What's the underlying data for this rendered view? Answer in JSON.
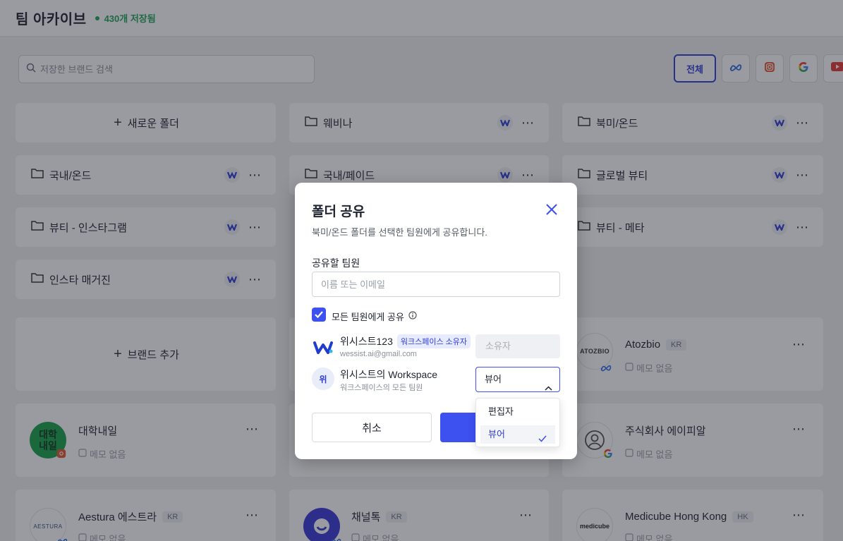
{
  "header": {
    "title": "팀 아카이브",
    "saved_count": "430개 저장됨"
  },
  "search": {
    "placeholder": "저장한 브랜드 검색"
  },
  "filters": {
    "all_label": "전체",
    "icons": [
      "meta-icon",
      "instagram-icon",
      "google-icon",
      "youtube-icon"
    ]
  },
  "folders": {
    "new_folder": "새로운 폴더",
    "items": [
      "웨비나",
      "북미/온드",
      "국내/온드",
      "국내/페이드",
      "글로벌 뷰티",
      "뷰티 - 인스타그램",
      "뷰티 - 메타",
      "인스타 매거진"
    ]
  },
  "brand_add": "브랜드 추가",
  "brands": [
    {
      "name": "Atozbio",
      "region": "KR",
      "memo": "메모 없음",
      "logo_text": "ATOZBIO"
    },
    {
      "name": "대학내일",
      "memo": "메모 없음",
      "logo_text": "대학\n내일"
    },
    {
      "name": "주식회사 에이피알",
      "memo": "메모 없음"
    },
    {
      "name": "Aestura 에스트라",
      "region": "KR",
      "memo": "메모 없음",
      "logo_text": "AESTURA"
    },
    {
      "name": "채널톡",
      "region": "KR",
      "memo": "메모 없음"
    },
    {
      "name": "Medicube Hong Kong",
      "region": "HK",
      "memo": "메모 없음",
      "logo_text": "medicube"
    }
  ],
  "dialog": {
    "title": "폴더 공유",
    "description": "북미/온드 폴더를 선택한 팀원에게 공유합니다.",
    "member_label": "공유할 팀원",
    "member_placeholder": "이름 또는 이메일",
    "share_all_label": "모든 팀원에게 공유",
    "owner": {
      "name": "위시스트123",
      "tag": "워크스페이스 소유자",
      "email": "wessist.ai@gmail.com",
      "role": "소유자"
    },
    "workspace": {
      "avatar": "위",
      "name": "위시스트의 Workspace",
      "sub": "워크스페이스의 모든 팀원",
      "role": "뷰어"
    },
    "cancel_label": "취소",
    "role_options": [
      "편집자",
      "뷰어"
    ]
  },
  "colors": {
    "accent": "#3d50f0",
    "saved_green": "#22a45a"
  }
}
